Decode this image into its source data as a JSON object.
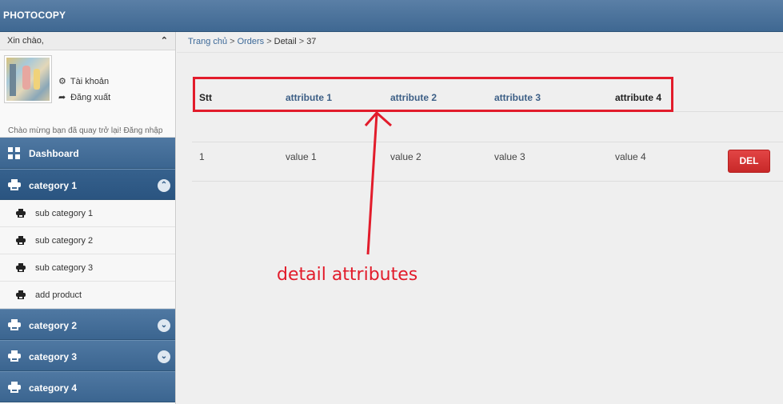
{
  "app": {
    "title": "PHOTOCOPY"
  },
  "user": {
    "greeting": "Xin chào,",
    "account_link": "Tài khoản",
    "logout_link": "Đăng xuất",
    "welcome_text": "Chào mừng bạn đã quay trở lại! Đăng nhập lần cuối vào lúc Chưa xác định"
  },
  "sidebar": {
    "dashboard": "Dashboard",
    "categories": [
      {
        "label": "category 1",
        "expanded": true,
        "items": [
          "sub category 1",
          "sub category 2",
          "sub category 3",
          "add product"
        ]
      },
      {
        "label": "category 2",
        "expanded": false
      },
      {
        "label": "category 3",
        "expanded": false
      },
      {
        "label": "category 4",
        "expanded": false
      }
    ]
  },
  "breadcrumb": {
    "home": "Trang chủ",
    "orders": "Orders",
    "detail": "Detail",
    "id": "37",
    "sep": ">"
  },
  "table": {
    "headers": [
      "Stt",
      "attribute 1",
      "attribute 2",
      "attribute 3",
      "attribute 4"
    ],
    "rows": [
      {
        "stt": "1",
        "values": [
          "value 1",
          "value 2",
          "value 3",
          "value 4"
        ],
        "action": "DEL"
      }
    ]
  },
  "annotation": {
    "text": "detail attributes",
    "color": "#e21c2b"
  },
  "colors": {
    "header": "#3f6892",
    "link": "#3d6a99",
    "danger": "#d63333"
  }
}
